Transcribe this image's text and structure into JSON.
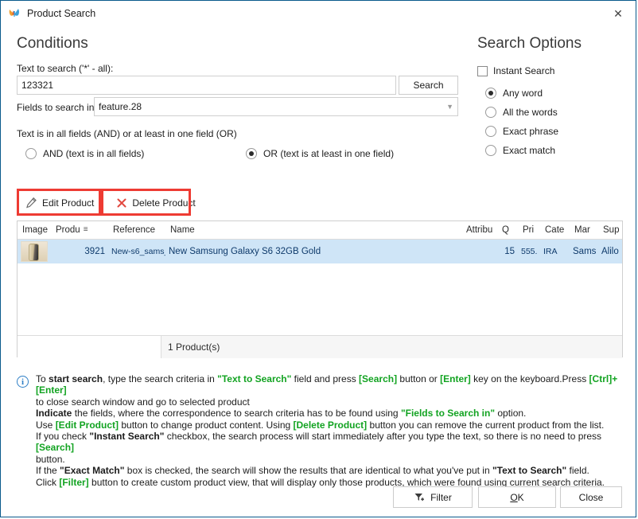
{
  "window": {
    "title": "Product Search",
    "app_icon": "butterfly-icon",
    "help_button": "?",
    "close_button": "✕"
  },
  "conditions": {
    "heading": "Conditions",
    "text_to_search_label": "Text to search ('*' - all):",
    "text_to_search_value": "123321",
    "text_to_search_placeholder": "",
    "search_button": "Search",
    "fields_to_search_label": "Fields to search in",
    "fields_to_search_value": "feature.28",
    "and_or_label": "Text is in all fields (AND) or at least in one field (OR)",
    "and_option": "AND (text is in all fields)",
    "or_option": "OR (text is at least in one field)",
    "and_selected": false,
    "or_selected": true
  },
  "search_options": {
    "heading": "Search Options",
    "instant_search_label": "Instant Search",
    "instant_search_checked": false,
    "radios": [
      {
        "label": "Any word",
        "selected": true
      },
      {
        "label": "All the words",
        "selected": false
      },
      {
        "label": "Exact phrase",
        "selected": false
      },
      {
        "label": "Exact match",
        "selected": false
      }
    ]
  },
  "actions": {
    "edit_product": "Edit Product",
    "edit_icon": "pencil-icon",
    "delete_product": "Delete Product",
    "delete_icon": "cross-icon",
    "annotation_color": "#ee3b33"
  },
  "grid": {
    "columns": [
      "Image",
      "Produ",
      "Reference",
      "Name",
      "Attribu",
      "Q",
      "Pri",
      "Cate",
      "Mar",
      "Sup"
    ],
    "sorted_column_index": 1,
    "sort_indicator": "≡",
    "rows": [
      {
        "image": "phone-thumbnail",
        "product_id": "3921",
        "reference": "New-s6_sams_",
        "name": "New Samsung Galaxy S6 32GB Gold",
        "attribute": "",
        "quantity": "15",
        "price": "555.",
        "category": "IRA",
        "manufacturer": "Sams",
        "supplier": "Alilo"
      }
    ],
    "row_selected_color": "#cfe5f7",
    "footer_count": "1 Product(s)"
  },
  "help": {
    "info_icon": "info-icon",
    "lines": [
      [
        {
          "t": "To ",
          "s": "n"
        },
        {
          "t": "start search",
          "s": "b"
        },
        {
          "t": ", type the search criteria in ",
          "s": "n"
        },
        {
          "t": "\"Text to Search\"",
          "s": "g"
        },
        {
          "t": " field and press ",
          "s": "n"
        },
        {
          "t": "[Search]",
          "s": "g"
        },
        {
          "t": " button or ",
          "s": "n"
        },
        {
          "t": "[Enter]",
          "s": "g"
        },
        {
          "t": " key on the keyboard.Press ",
          "s": "n"
        },
        {
          "t": "[Ctrl]+[Enter]",
          "s": "g"
        }
      ],
      [
        {
          "t": "to close search window and go to selected product",
          "s": "n"
        }
      ],
      [
        {
          "t": "Indicate",
          "s": "b"
        },
        {
          "t": " the fields, where the correspondence to search criteria has to be found using ",
          "s": "n"
        },
        {
          "t": "\"Fields to Search in\"",
          "s": "g"
        },
        {
          "t": " option.",
          "s": "n"
        }
      ],
      [
        {
          "t": "Use ",
          "s": "n"
        },
        {
          "t": "[Edit Product]",
          "s": "g"
        },
        {
          "t": " button to change product content. Using ",
          "s": "n"
        },
        {
          "t": "[Delete Product]",
          "s": "g"
        },
        {
          "t": " button you can remove the current product from the list.",
          "s": "n"
        }
      ],
      [
        {
          "t": "If you check ",
          "s": "n"
        },
        {
          "t": "\"Instant Search\"",
          "s": "b"
        },
        {
          "t": " checkbox, the search process will start immediately after you type the text, so there is no need to press ",
          "s": "n"
        },
        {
          "t": "[Search]",
          "s": "g"
        }
      ],
      [
        {
          "t": "button.",
          "s": "n"
        }
      ],
      [
        {
          "t": "If the ",
          "s": "n"
        },
        {
          "t": "\"Exact Match\"",
          "s": "b"
        },
        {
          "t": " box is checked, the search will show the results that are identical to what you've put in ",
          "s": "n"
        },
        {
          "t": "\"Text to Search\"",
          "s": "b"
        },
        {
          "t": " field.",
          "s": "n"
        }
      ],
      [
        {
          "t": "Click ",
          "s": "n"
        },
        {
          "t": "[Filter]",
          "s": "g"
        },
        {
          "t": " button to create custom product view, that will display only those products, which were found using current search criteria.",
          "s": "n"
        }
      ]
    ]
  },
  "footer": {
    "filter_button": "Filter",
    "filter_icon": "funnel-plus-icon",
    "ok_button": "OK",
    "ok_accel": "O",
    "close_button": "Close"
  }
}
